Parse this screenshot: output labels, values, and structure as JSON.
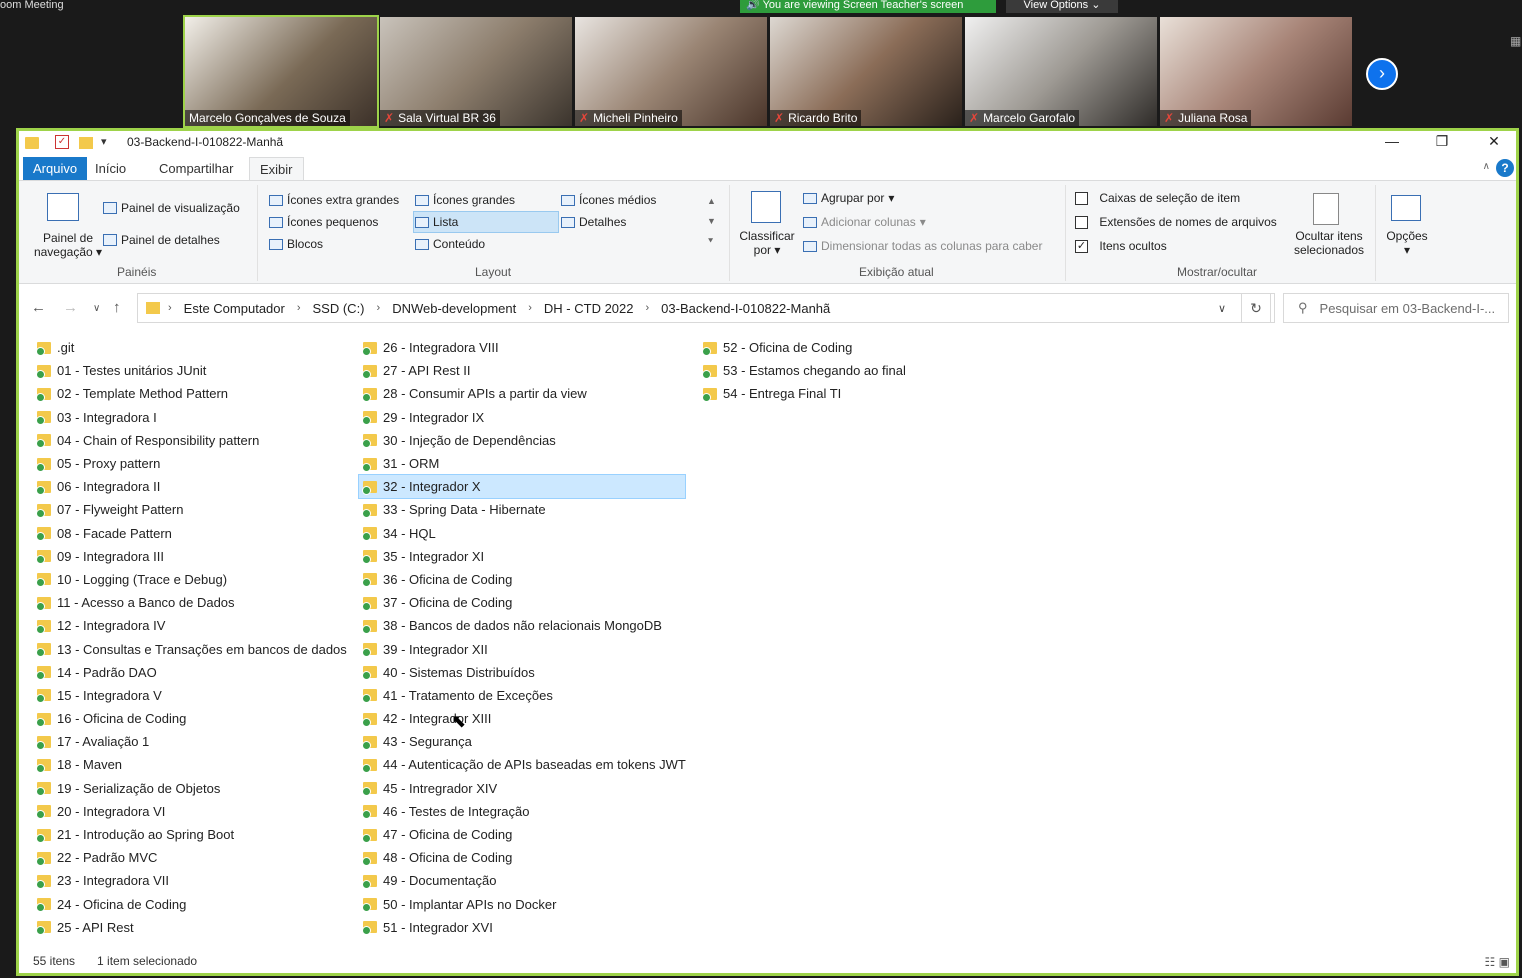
{
  "zoom": {
    "title": "oom Meeting",
    "share_banner": "You are viewing Screen Teacher's screen",
    "view_options": "View Options ⌄",
    "participants": [
      {
        "name": "Marcelo Gonçalves de Souza",
        "muted": false,
        "active": true,
        "color": "#7a6a56"
      },
      {
        "name": "Sala Virtual BR 36",
        "muted": true,
        "active": false,
        "color": "#8c7d6c"
      },
      {
        "name": "Micheli Pinheiro",
        "muted": true,
        "active": false,
        "color": "#9a8574"
      },
      {
        "name": "Ricardo Brito",
        "muted": true,
        "active": false,
        "color": "#8b6d58"
      },
      {
        "name": "Marcelo Garofalo",
        "muted": true,
        "active": false,
        "color": "#9e9a94"
      },
      {
        "name": "Juliana Rosa",
        "muted": true,
        "active": false,
        "color": "#a88578"
      }
    ],
    "next_icon": "chevron-right-icon"
  },
  "window": {
    "title": "03-Backend-I-010822-Manhã",
    "tabs": [
      "Arquivo",
      "Início",
      "Compartilhar",
      "Exibir"
    ],
    "active_tab": "Exibir"
  },
  "ribbon": {
    "paineis": {
      "label": "Painéis",
      "nav_pane": "Painel de navegação",
      "preview_pane": "Painel de visualização",
      "details_pane": "Painel de detalhes"
    },
    "layout": {
      "label": "Layout",
      "options": [
        "Ícones extra grandes",
        "Ícones grandes",
        "Ícones médios",
        "Ícones pequenos",
        "Lista",
        "Detalhes",
        "Blocos",
        "Conteúdo"
      ],
      "selected": "Lista"
    },
    "exibicao": {
      "label": "Exibição atual",
      "sort": "Classificar por",
      "group": "Agrupar por",
      "add_cols": "Adicionar colunas",
      "fit_cols": "Dimensionar todas as colunas para caber"
    },
    "mostrar": {
      "label": "Mostrar/ocultar",
      "checkboxes": [
        {
          "label": "Caixas de seleção de item",
          "checked": false
        },
        {
          "label": "Extensões de nomes de arquivos",
          "checked": false
        },
        {
          "label": "Itens ocultos",
          "checked": true
        }
      ],
      "hide_selected": "Ocultar itens selecionados",
      "options": "Opções"
    }
  },
  "address": {
    "crumbs": [
      "Este Computador",
      "SSD (C:)",
      "DNWeb-development",
      "DH - CTD 2022",
      "03-Backend-I-010822-Manhã"
    ],
    "search_placeholder": "Pesquisar em 03-Backend-I-..."
  },
  "files": {
    "col1": [
      ".git",
      "01 - Testes unitários JUnit",
      "02 - Template Method Pattern",
      "03 - Integradora I",
      "04 - Chain of Responsibility pattern",
      "05 - Proxy pattern",
      "06 - Integradora II",
      "07 - Flyweight Pattern",
      "08 - Facade Pattern",
      "09 - Integradora III",
      "10 - Logging (Trace e Debug)",
      "11 - Acesso a Banco de Dados",
      "12 - Integradora IV",
      "13 - Consultas e Transações em bancos de dados",
      "14 - Padrão DAO",
      "15 - Integradora V",
      "16 - Oficina de Coding",
      "17 - Avaliação 1",
      "18 - Maven",
      "19 - Serialização de Objetos",
      "20 - Integradora VI",
      "21 - Introdução ao Spring Boot",
      "22 - Padrão MVC",
      "23 - Integradora VII",
      "24 - Oficina de Coding",
      "25 - API Rest"
    ],
    "col2": [
      "26 - Integradora VIII",
      "27 - API Rest II",
      "28 - Consumir APIs a partir da view",
      "29 - Integrador IX",
      "30 - Injeção de Dependências",
      "31 - ORM",
      "32 - Integrador X",
      "33 - Spring Data - Hibernate",
      "34 - HQL",
      "35 - Integrador XI",
      "36 - Oficina de Coding",
      "37 - Oficina de Coding",
      "38 - Bancos de dados não relacionais MongoDB",
      "39 - Integrador XII",
      "40 - Sistemas Distribuídos",
      "41 - Tratamento de Exceções",
      "42 - Integrador XIII",
      "43 - Segurança",
      "44 - Autenticação de APIs baseadas em tokens JWT",
      "45 - Intregrador XIV",
      "46 - Testes de Integração",
      "47 - Oficina de Coding",
      "48 - Oficina de Coding",
      "49 - Documentação",
      "50 - Implantar APIs no Docker",
      "51 - Integrador XVI"
    ],
    "col3": [
      "52 - Oficina de Coding",
      "53 - Estamos chegando ao final",
      "54 - Entrega Final TI"
    ],
    "selected": "32 - Integrador X"
  },
  "status": {
    "count": "55 itens",
    "selection": "1 item selecionado"
  },
  "colors": {
    "accent": "#1979ca",
    "zoom_green": "#9ed34a",
    "selection": "#cce8ff"
  }
}
